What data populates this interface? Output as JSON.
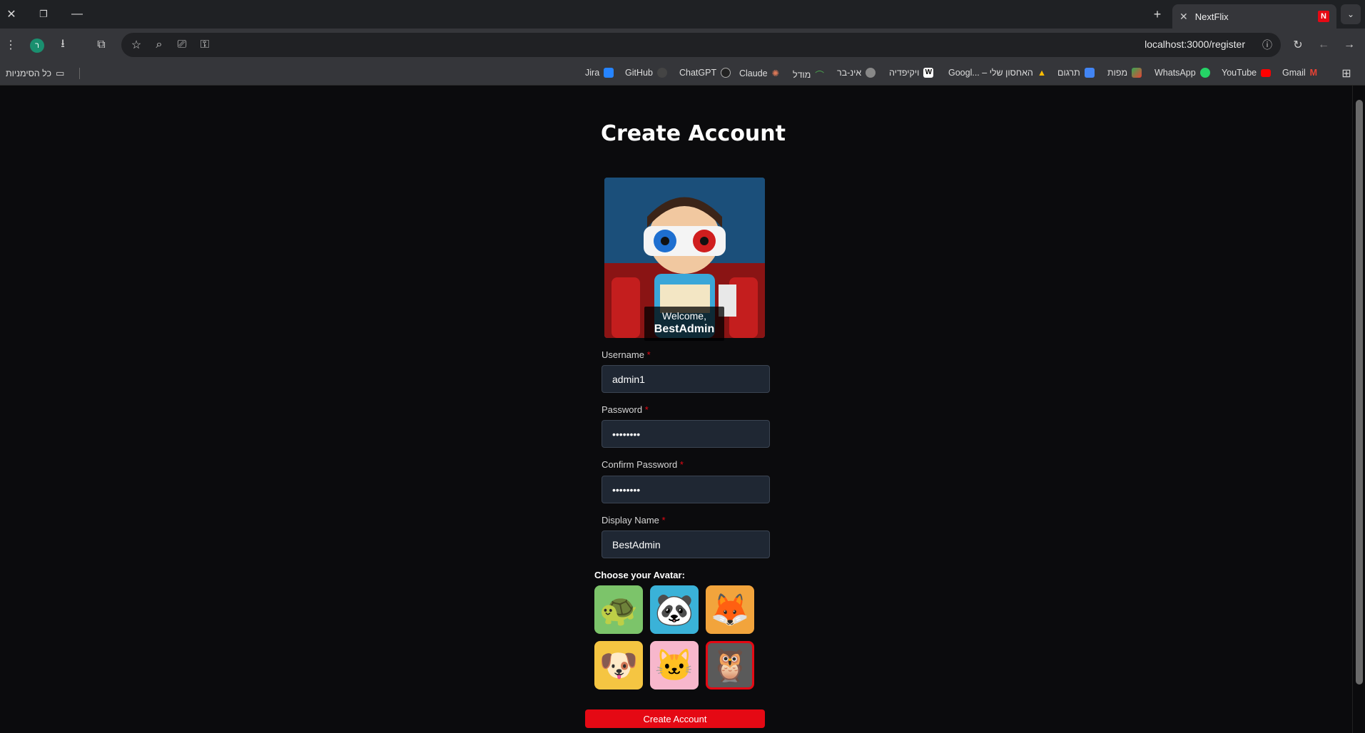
{
  "browser": {
    "tab_title": "NextFlix",
    "url": "localhost:3000/register",
    "profile_initial": "ר",
    "bookmarks": [
      {
        "label": "Jira",
        "color": "#2684ff"
      },
      {
        "label": "GitHub",
        "color": "#444444"
      },
      {
        "label": "ChatGPT",
        "color": "#10a37f"
      },
      {
        "label": "Claude",
        "color": "#d97757"
      },
      {
        "label": "מודל",
        "color": "#4caf50"
      },
      {
        "label": "אינ-בר",
        "color": "#888888"
      },
      {
        "label": "ויקיפדיה",
        "color": "#ffffff"
      },
      {
        "label": "Googl... – האחסון שלי",
        "color": "#fbbc04"
      },
      {
        "label": "תרגום",
        "color": "#4285f4"
      },
      {
        "label": "מפות",
        "color": "#34a853"
      },
      {
        "label": "WhatsApp",
        "color": "#25d366"
      },
      {
        "label": "YouTube",
        "color": "#ff0000"
      },
      {
        "label": "Gmail",
        "color": "#ea4335"
      }
    ],
    "all_bookmarks_label": "כל הסימניות"
  },
  "page": {
    "title": "Create Account",
    "welcome_line": "Welcome,",
    "welcome_name": "BestAdmin",
    "fields": {
      "username": {
        "label": "Username",
        "value": "admin1"
      },
      "password": {
        "label": "Password",
        "value": "••••••••"
      },
      "confirm_password": {
        "label": "Confirm Password",
        "value": "••••••••"
      },
      "display_name": {
        "label": "Display Name",
        "value": "BestAdmin"
      }
    },
    "required_mark": "*",
    "avatar_heading": "Choose your Avatar:",
    "avatars": [
      {
        "name": "turtle",
        "emoji": "🐢",
        "bg": "#7cc46a",
        "selected": false
      },
      {
        "name": "panda",
        "emoji": "🐼",
        "bg": "#3ab2d8",
        "selected": false
      },
      {
        "name": "fox",
        "emoji": "🦊",
        "bg": "#f2a43c",
        "selected": false
      },
      {
        "name": "dog",
        "emoji": "🐶",
        "bg": "#f5c542",
        "selected": false
      },
      {
        "name": "cat",
        "emoji": "🐱",
        "bg": "#f7b7cc",
        "selected": false
      },
      {
        "name": "owl",
        "emoji": "🦉",
        "bg": "#5a5a5a",
        "selected": true
      }
    ],
    "submit_label": "Create Account"
  }
}
